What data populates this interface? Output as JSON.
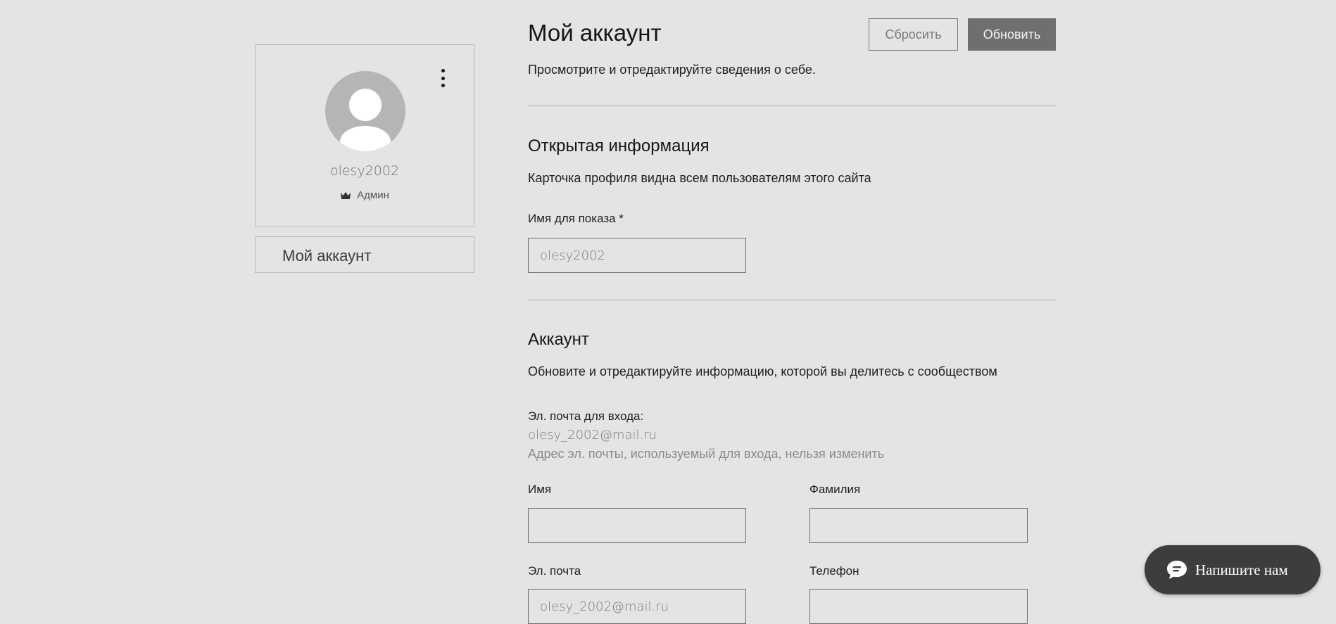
{
  "profile": {
    "username": "olesy2002",
    "role": "Админ",
    "menu_icon": "more-vertical-icon",
    "avatar_icon": "user-silhouette-icon",
    "role_icon": "crown-icon"
  },
  "sidebar": {
    "items": [
      {
        "label": "Мой аккаунт"
      }
    ]
  },
  "header": {
    "title": "Мой аккаунт",
    "subtitle": "Просмотрите и отредактируйте сведения о себе.",
    "reset_label": "Сбросить",
    "update_label": "Обновить"
  },
  "public_info": {
    "title": "Открытая информация",
    "subtitle": "Карточка профиля видна всем пользователям этого сайта",
    "display_name_label": "Имя для показа *",
    "display_name_value": "olesy2002"
  },
  "account": {
    "title": "Аккаунт",
    "subtitle": "Обновите и отредактируйте информацию, которой вы делитесь с сообществом",
    "login_email_label": "Эл. почта для входа:",
    "login_email_value": "olesy_2002@mail.ru",
    "login_email_hint": "Адрес эл. почты, используемый для входа, нельзя изменить",
    "first_name_label": "Имя",
    "first_name_value": "",
    "last_name_label": "Фамилия",
    "last_name_value": "",
    "email_label": "Эл. почта",
    "email_value": "olesy_2002@mail.ru",
    "phone_label": "Телефон",
    "phone_value": ""
  },
  "chat": {
    "label": "Напишите нам",
    "icon": "chat-bubble-icon"
  },
  "colors": {
    "background": "#e4e4e2",
    "update_button": "#6f6f6f",
    "chat_button": "#3d3d3d",
    "avatar": "#b5b5b5"
  }
}
